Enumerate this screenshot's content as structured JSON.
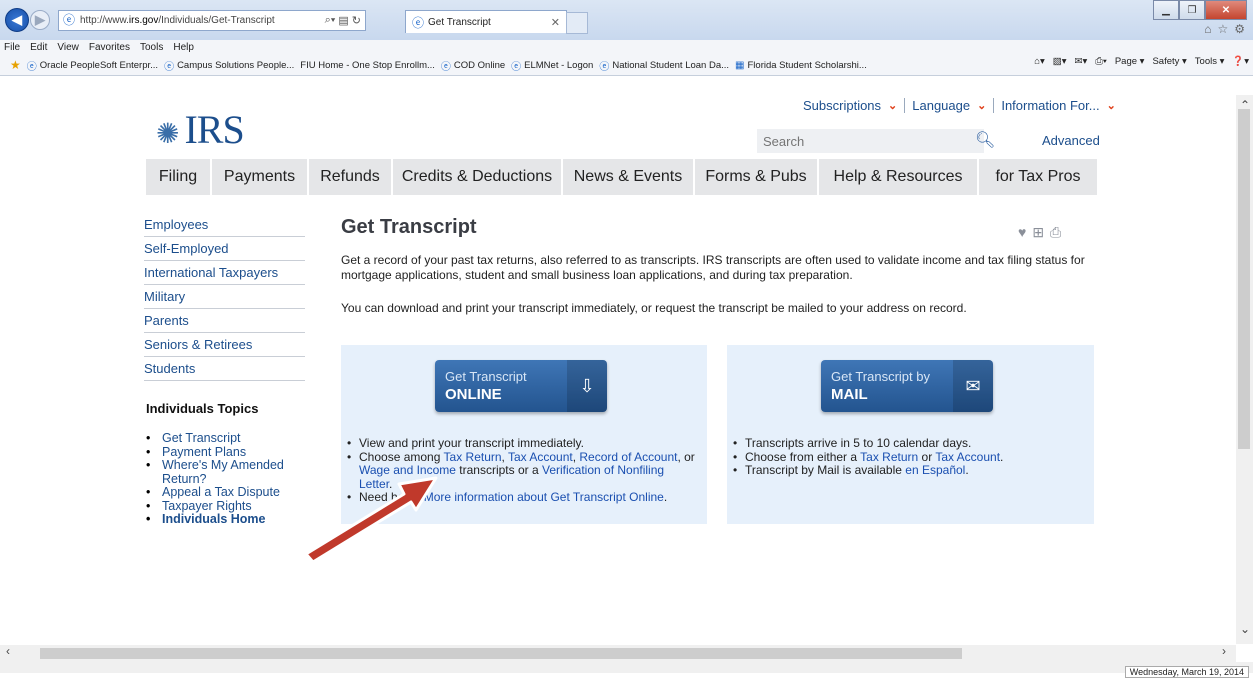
{
  "browser": {
    "url_prefix": "http://www.",
    "url_domain": "irs.gov",
    "url_path": "/Individuals/Get-Transcript",
    "tab_title": "Get Transcript",
    "menu": [
      "File",
      "Edit",
      "View",
      "Favorites",
      "Tools",
      "Help"
    ],
    "favorites": [
      "Oracle PeopleSoft Enterpr...",
      "Campus Solutions People...",
      "FIU Home - One Stop Enrollm...",
      "COD Online",
      "ELMNet - Logon",
      "National Student Loan Da...",
      "Florida Student Scholarshi..."
    ],
    "commands": [
      "Page ▾",
      "Safety ▾",
      "Tools ▾"
    ],
    "status_date": "Wednesday, March 19, 2014"
  },
  "irs": {
    "logo_text": "IRS",
    "toplinks": [
      "Subscriptions",
      "Language",
      "Information For..."
    ],
    "search_placeholder": "Search",
    "advanced": "Advanced",
    "nav": [
      "Filing",
      "Payments",
      "Refunds",
      "Credits & Deductions",
      "News & Events",
      "Forms & Pubs",
      "Help & Resources",
      "for Tax Pros"
    ]
  },
  "leftnav": [
    "Employees",
    "Self-Employed",
    "International Taxpayers",
    "Military",
    "Parents",
    "Seniors & Retirees",
    "Students"
  ],
  "topics": {
    "heading": "Individuals Topics",
    "items": [
      "Get Transcript",
      "Payment Plans",
      "Where's My Amended Return?",
      "Appeal a Tax Dispute",
      "Taxpayer Rights",
      "Individuals Home"
    ]
  },
  "content": {
    "title": "Get Transcript",
    "intro1": "Get a record of your past tax returns, also referred to as transcripts. IRS transcripts are often used to validate income and tax filing status for mortgage applications, student and small business loan applications, and during tax preparation.",
    "intro2": "You can download and print your transcript immediately, or request the transcript be mailed to your address on record.",
    "online": {
      "line1": "Get Transcript",
      "line2": "ONLINE",
      "b1": "View and print your transcript immediately.",
      "b2_pre": "Choose among ",
      "b2_l1": "Tax Return",
      "b2_l2": "Tax Account",
      "b2_l3": "Record of Account",
      "b2_or": ", or ",
      "b2_l4": "Wage and Income",
      "b2_mid": " transcripts or a ",
      "b2_l5": "Verification of Nonfiling Letter",
      "b3_pre": "Need help? ",
      "b3_link": "More information about Get Transcript Online"
    },
    "mail": {
      "line1": "Get Transcript by",
      "line2": "MAIL",
      "b1": "Transcripts arrive in 5 to 10 calendar days.",
      "b2_pre": "Choose from either a ",
      "b2_l1": "Tax Return",
      "b2_or": " or ",
      "b2_l2": "Tax Account",
      "b3_pre": "Transcript by Mail is available ",
      "b3_link": "en Español"
    }
  },
  "colors": {
    "accent": "#1c4e8c",
    "button": "#2f63a3",
    "panel": "#e6f0fb",
    "arrow": "#c0392b"
  }
}
